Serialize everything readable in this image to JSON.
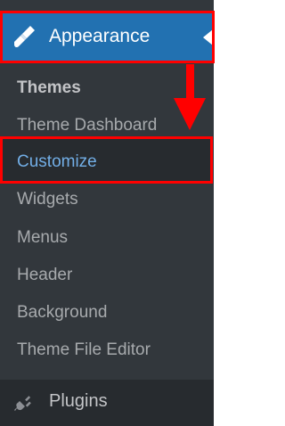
{
  "menu": {
    "appearance": {
      "label": "Appearance",
      "icon": "paintbrush-icon"
    },
    "submenu": {
      "section_title": "Themes",
      "items": [
        {
          "label": "Theme Dashboard"
        },
        {
          "label": "Customize",
          "active": true
        },
        {
          "label": "Widgets"
        },
        {
          "label": "Menus"
        },
        {
          "label": "Header"
        },
        {
          "label": "Background"
        },
        {
          "label": "Theme File Editor"
        }
      ]
    },
    "plugins": {
      "label": "Plugins",
      "icon": "plug-icon"
    }
  },
  "colors": {
    "sidebar_bg": "#32373c",
    "active_bg": "#2271b1",
    "highlight_red": "#ff0000",
    "active_text": "#72aee6"
  }
}
